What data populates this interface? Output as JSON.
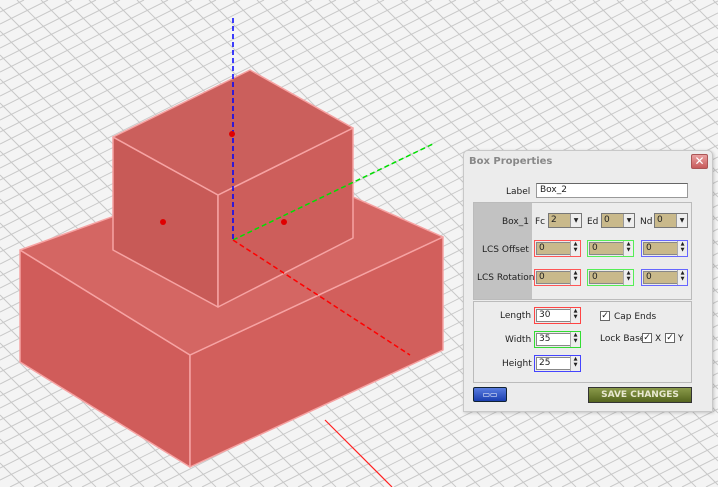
{
  "dialog": {
    "title": "Box Properties",
    "close_icon": "close-icon",
    "label_caption": "Label",
    "label_value": "Box_2",
    "ref": {
      "caption": "Box_1",
      "fc_label": "Fc",
      "fc_value": "2",
      "ed_label": "Ed",
      "ed_value": "0",
      "nd_label": "Nd",
      "nd_value": "0"
    },
    "lcs_offset": {
      "caption": "LCS Offset",
      "x": "0",
      "y": "0",
      "z": "0"
    },
    "lcs_rotation": {
      "caption": "LCS Rotation",
      "x": "0",
      "y": "0",
      "z": "0"
    },
    "length": {
      "caption": "Length",
      "value": "30"
    },
    "width": {
      "caption": "Width",
      "value": "35"
    },
    "height": {
      "caption": "Height",
      "value": "25"
    },
    "cap_ends": {
      "label": "Cap Ends",
      "checked": true
    },
    "lock_base": {
      "label": "Lock Base",
      "x_label": "X",
      "y_label": "Y",
      "x_checked": true,
      "y_checked": true
    },
    "view_button_icon": "glasses-icon",
    "save_label": "SAVE CHANGES"
  },
  "colors": {
    "box_fill": "#d9625f",
    "box_edge": "#f7a0a0",
    "axis_x": "#ff0000",
    "axis_y": "#00dd00",
    "axis_z": "#0000ff"
  }
}
